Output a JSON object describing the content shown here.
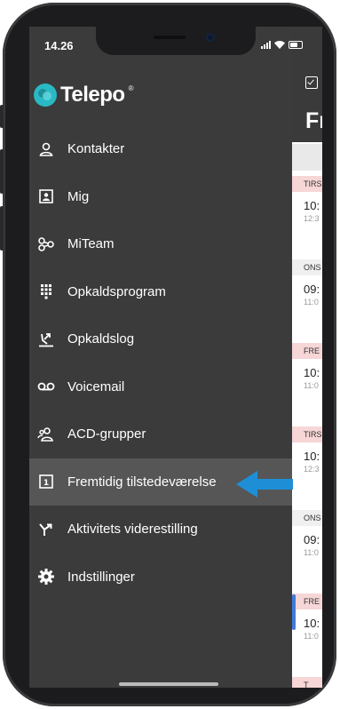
{
  "status_bar": {
    "time": "14.26"
  },
  "brand": {
    "name": "Telepo",
    "accent": "#29b9c4"
  },
  "menu": {
    "items": [
      {
        "label": "Kontakter",
        "icon": "person-icon"
      },
      {
        "label": "Mig",
        "icon": "id-card-icon"
      },
      {
        "label": "MiTeam",
        "icon": "team-icon"
      },
      {
        "label": "Opkaldsprogram",
        "icon": "dialpad-icon"
      },
      {
        "label": "Opkaldslog",
        "icon": "call-log-icon"
      },
      {
        "label": "Voicemail",
        "icon": "voicemail-icon"
      },
      {
        "label": "ACD-grupper",
        "icon": "group-icon"
      },
      {
        "label": "Fremtidig tilstedeværelse",
        "icon": "calendar-icon",
        "active": true
      },
      {
        "label": "Aktivitets viderestilling",
        "icon": "forward-icon"
      },
      {
        "label": "Indstillinger",
        "icon": "gear-icon"
      }
    ],
    "active_bg": "#565656"
  },
  "annotation": {
    "arrow_color": "#1e8fd6"
  },
  "content": {
    "title": "Fr",
    "entries": [
      {
        "day": "TIRS",
        "time": "10:",
        "sub": "12:3"
      },
      {
        "day": "ONS",
        "time": "09:",
        "sub": "11:0"
      },
      {
        "day": "FRE",
        "time": "10:",
        "sub": "11:0"
      },
      {
        "day": "TIRS",
        "time": "10:",
        "sub": "12:3"
      },
      {
        "day": "ONS",
        "time": "09:",
        "sub": "11:0"
      },
      {
        "day": "FRE",
        "time": "10:",
        "sub": "11:0"
      },
      {
        "day": "T",
        "time": "",
        "sub": ""
      }
    ]
  }
}
